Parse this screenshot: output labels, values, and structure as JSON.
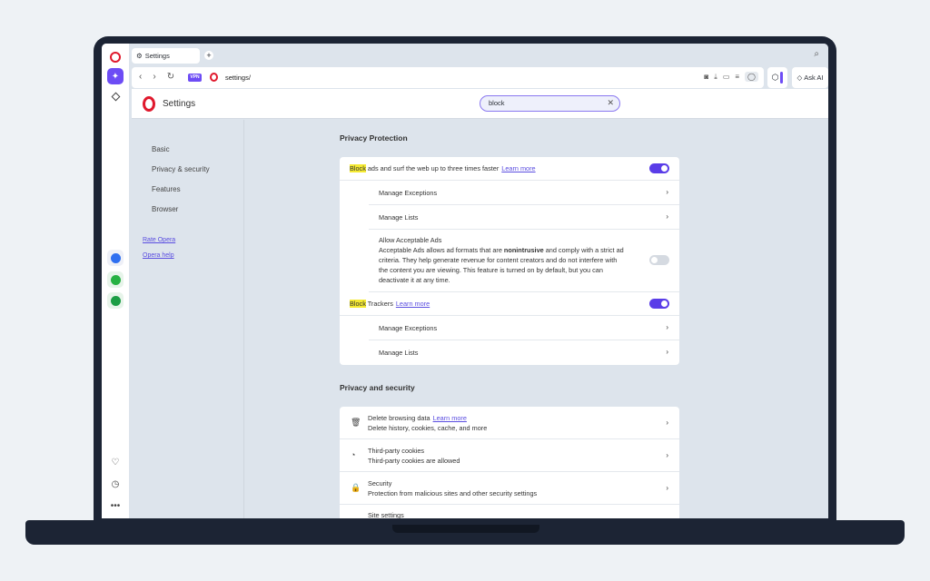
{
  "tab": {
    "label": "Settings",
    "add": "+"
  },
  "address": {
    "vpn": "VPN",
    "url": "settings/"
  },
  "askai": "Ask AI",
  "header": {
    "title": "Settings"
  },
  "search": {
    "value": "block"
  },
  "nav": {
    "items": [
      "Basic",
      "Privacy & security",
      "Features",
      "Browser"
    ],
    "links": [
      "Rate Opera",
      "Opera help"
    ]
  },
  "privacy_protection": {
    "title": "Privacy Protection",
    "block_ads": {
      "highlight": "Block",
      "text": " ads and surf the web up to three times faster",
      "link": "Learn more",
      "enabled": true
    },
    "ads_manage_exceptions": "Manage Exceptions",
    "ads_manage_lists": "Manage Lists",
    "acceptable_ads": {
      "title": "Allow Acceptable Ads",
      "desc_1": "Acceptable Ads allows ad formats that are ",
      "desc_bold": "nonintrusive",
      "desc_2": " and comply with a strict ad",
      "desc_3": "criteria. They help generate revenue for content creators and do not interfere with",
      "desc_4": "the content you are viewing. This feature is turned on by default, but you can",
      "desc_5": "deactivate it at any time.",
      "enabled": false
    },
    "block_trackers": {
      "highlight": "Block",
      "text": " Trackers",
      "link": "Learn more",
      "enabled": true
    },
    "trackers_manage_exceptions": "Manage Exceptions",
    "trackers_manage_lists": "Manage Lists"
  },
  "privacy_security": {
    "title": "Privacy and security",
    "items": [
      {
        "title": "Delete browsing data",
        "link": "Learn more",
        "desc": "Delete history, cookies, cache, and more",
        "icon": "trash-icon"
      },
      {
        "title": "Third-party cookies",
        "desc": "Third-party cookies are allowed",
        "icon": "cookie-icon"
      },
      {
        "title": "Security",
        "desc": "Protection from malicious sites and other security settings",
        "icon": "lock-icon"
      },
      {
        "title": "Site settings"
      }
    ]
  },
  "colors": {
    "accent": "#5a3de8",
    "opera_red": "#e0192d",
    "highlight": "#f5ea33"
  }
}
